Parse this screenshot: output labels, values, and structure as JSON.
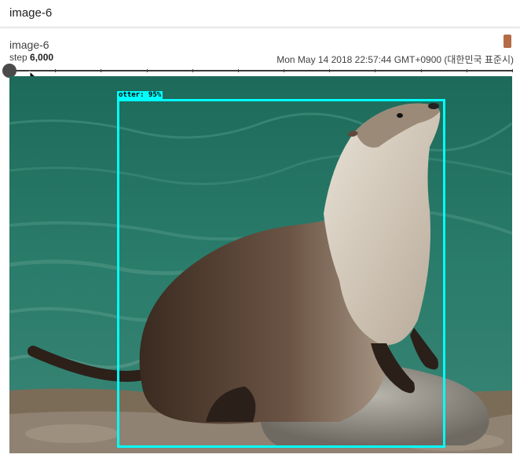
{
  "header": {
    "title": "image-6"
  },
  "card": {
    "title": "image-6",
    "step_label": "step",
    "step_value": "6,000",
    "timestamp": "Mon May 14 2018 22:57:44 GMT+0900 (대한민국 표준시)",
    "run_color": "#b56b45"
  },
  "slider": {
    "tick_count": 12
  },
  "image": {
    "detection_label": "otter: 95%",
    "box_color": "#00ffff"
  }
}
